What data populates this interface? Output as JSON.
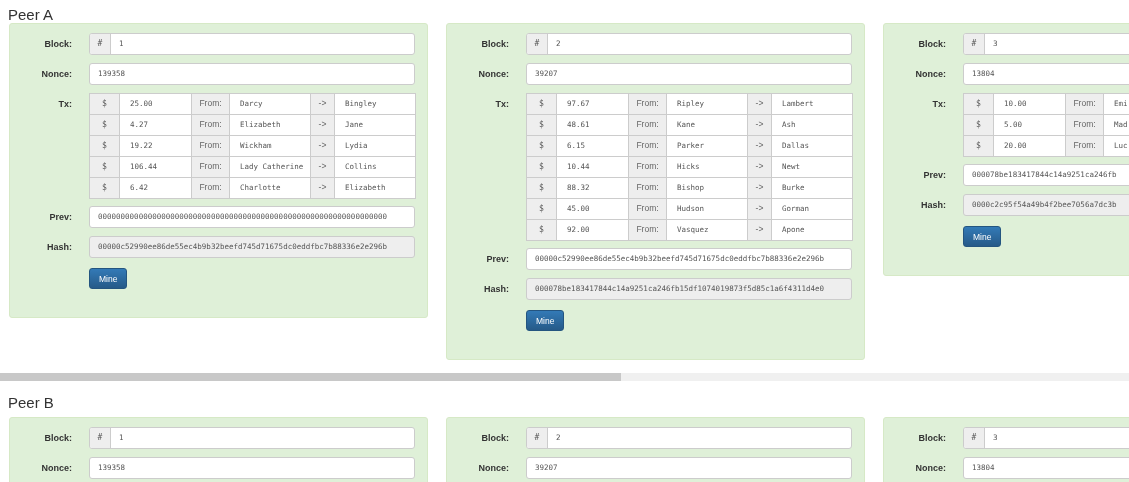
{
  "peers": [
    {
      "title": "Peer A",
      "blocks": [
        {
          "valid": true,
          "block_label": "Block:",
          "hash_symbol": "#",
          "block": "1",
          "nonce_label": "Nonce:",
          "nonce": "139358",
          "tx_label": "Tx:",
          "tx": [
            {
              "currency": "$",
              "amount": "25.00",
              "from_label": "From:",
              "from": "Darcy",
              "arrow": "->",
              "to": "Bingley"
            },
            {
              "currency": "$",
              "amount": "4.27",
              "from_label": "From:",
              "from": "Elizabeth",
              "arrow": "->",
              "to": "Jane"
            },
            {
              "currency": "$",
              "amount": "19.22",
              "from_label": "From:",
              "from": "Wickham",
              "arrow": "->",
              "to": "Lydia"
            },
            {
              "currency": "$",
              "amount": "106.44",
              "from_label": "From:",
              "from": "Lady Catherine",
              "arrow": "->",
              "to": "Collins"
            },
            {
              "currency": "$",
              "amount": "6.42",
              "from_label": "From:",
              "from": "Charlotte",
              "arrow": "->",
              "to": "Elizabeth"
            }
          ],
          "prev_label": "Prev:",
          "prev": "0000000000000000000000000000000000000000000000000000000000000000",
          "hash_label": "Hash:",
          "hash": "00000c52990ee86de55ec4b9b32beefd745d71675dc0eddfbc7b88336e2e296b",
          "button": "Mine"
        },
        {
          "valid": true,
          "block_label": "Block:",
          "hash_symbol": "#",
          "block": "2",
          "nonce_label": "Nonce:",
          "nonce": "39207",
          "tx_label": "Tx:",
          "tx": [
            {
              "currency": "$",
              "amount": "97.67",
              "from_label": "From:",
              "from": "Ripley",
              "arrow": "->",
              "to": "Lambert"
            },
            {
              "currency": "$",
              "amount": "48.61",
              "from_label": "From:",
              "from": "Kane",
              "arrow": "->",
              "to": "Ash"
            },
            {
              "currency": "$",
              "amount": "6.15",
              "from_label": "From:",
              "from": "Parker",
              "arrow": "->",
              "to": "Dallas"
            },
            {
              "currency": "$",
              "amount": "10.44",
              "from_label": "From:",
              "from": "Hicks",
              "arrow": "->",
              "to": "Newt"
            },
            {
              "currency": "$",
              "amount": "88.32",
              "from_label": "From:",
              "from": "Bishop",
              "arrow": "->",
              "to": "Burke"
            },
            {
              "currency": "$",
              "amount": "45.00",
              "from_label": "From:",
              "from": "Hudson",
              "arrow": "->",
              "to": "Gorman"
            },
            {
              "currency": "$",
              "amount": "92.00",
              "from_label": "From:",
              "from": "Vasquez",
              "arrow": "->",
              "to": "Apone"
            }
          ],
          "prev_label": "Prev:",
          "prev": "00000c52990ee86de55ec4b9b32beefd745d71675dc0eddfbc7b88336e2e296b",
          "hash_label": "Hash:",
          "hash": "000078be183417844c14a9251ca246fb15df1074019873f5d85c1a6f4311d4e0",
          "button": "Mine"
        },
        {
          "valid": true,
          "block_label": "Block:",
          "hash_symbol": "#",
          "block": "3",
          "nonce_label": "Nonce:",
          "nonce": "13804",
          "tx_label": "Tx:",
          "tx": [
            {
              "currency": "$",
              "amount": "10.00",
              "from_label": "From:",
              "from": "Emi"
            },
            {
              "currency": "$",
              "amount": "5.00",
              "from_label": "From:",
              "from": "Mad"
            },
            {
              "currency": "$",
              "amount": "20.00",
              "from_label": "From:",
              "from": "Luc"
            }
          ],
          "prev_label": "Prev:",
          "prev": "000078be183417844c14a9251ca246fb",
          "hash_label": "Hash:",
          "hash": "0000c2c95f54a49b4f2bee7056a7dc3b",
          "button": "Mine"
        }
      ]
    },
    {
      "title": "Peer B",
      "blocks": [
        {
          "valid": true,
          "block_label": "Block:",
          "hash_symbol": "#",
          "block": "1",
          "nonce_label": "Nonce:",
          "nonce": "139358"
        },
        {
          "valid": true,
          "block_label": "Block:",
          "hash_symbol": "#",
          "block": "2",
          "nonce_label": "Nonce:",
          "nonce": "39207"
        },
        {
          "valid": true,
          "block_label": "Block:",
          "hash_symbol": "#",
          "block": "3",
          "nonce_label": "Nonce:",
          "nonce": "13804"
        }
      ]
    }
  ]
}
